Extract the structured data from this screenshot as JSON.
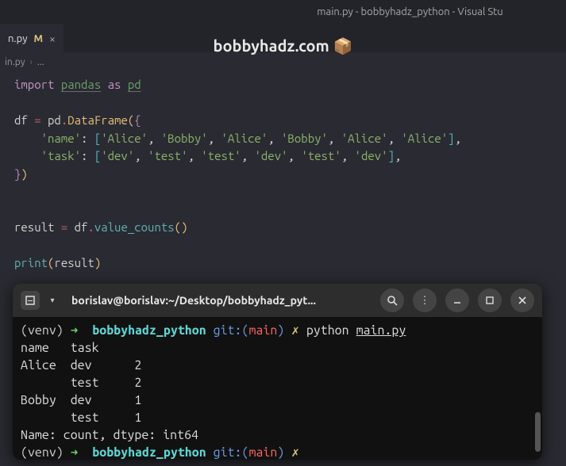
{
  "window": {
    "title": "main.py - bobbyhadz_python - Visual Stu"
  },
  "watermark": {
    "text": "bobbyhadz.com",
    "icon": "📦"
  },
  "tab": {
    "filename": "n.py",
    "modified": "M",
    "close": "×"
  },
  "breadcrumb": {
    "file": "in.py",
    "sep": "›",
    "dots": "..."
  },
  "code": {
    "l1": {
      "import": "import",
      "pandas": "pandas",
      "as": "as",
      "pd": "pd"
    },
    "l3a": "df",
    "l3eq": "=",
    "l3pd": "pd",
    "l3dot": ".",
    "l3cls": "DataFrame",
    "l4k": "'name'",
    "l4v": [
      "'Alice'",
      "'Bobby'",
      "'Alice'",
      "'Bobby'",
      "'Alice'",
      "'Alice'"
    ],
    "l5k": "'task'",
    "l5v": [
      "'dev'",
      "'test'",
      "'test'",
      "'dev'",
      "'test'",
      "'dev'"
    ],
    "l8a": "result",
    "l8eq": "=",
    "l8b": "df",
    "l8dot": ".",
    "l8fn": "value_counts",
    "l10fn": "print",
    "l10arg": "result"
  },
  "terminal": {
    "header_title": "borislav@borislav:~/Desktop/bobbyhadz_pyt...",
    "prompt1": {
      "venv": "(venv)",
      "arrow": "➜",
      "proj": "bobbyhadz_python",
      "git": "git:",
      "lp": "(",
      "branch": "main",
      "rp": ")",
      "x": "✗",
      "cmd": "python",
      "arg": "main.py"
    },
    "output": {
      "hdr": "name   task       ",
      "r1": "Alice  dev      2",
      "r2": "       test     2",
      "r3": "Bobby  dev      1",
      "r4": "       test     1",
      "dt": "Name: count, dtype: int64"
    },
    "prompt2": {
      "venv": "(venv)",
      "arrow": "➜",
      "proj": "bobbyhadz_python",
      "git": "git:",
      "lp": "(",
      "branch": "main",
      "rp": ")",
      "x": "✗"
    }
  },
  "chart_data": {
    "type": "table",
    "title": "pandas value_counts() output",
    "columns": [
      "name",
      "task",
      "count"
    ],
    "rows": [
      [
        "Alice",
        "dev",
        2
      ],
      [
        "Alice",
        "test",
        2
      ],
      [
        "Bobby",
        "dev",
        1
      ],
      [
        "Bobby",
        "test",
        1
      ]
    ],
    "dtype": "int64"
  }
}
